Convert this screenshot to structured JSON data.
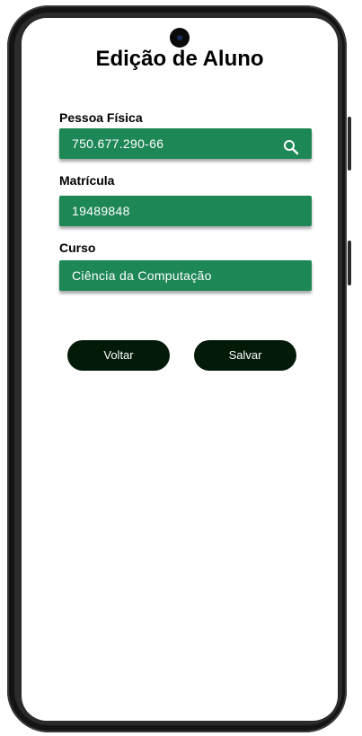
{
  "page": {
    "title": "Edição de Aluno"
  },
  "form": {
    "cpf": {
      "label": "Pessoa Física",
      "value": "750.677.290-66",
      "icon": "search-icon"
    },
    "matricula": {
      "label": "Matrícula",
      "value": "19489848"
    },
    "curso": {
      "label": "Curso",
      "value": "Ciência da Computação"
    }
  },
  "actions": {
    "back_label": "Voltar",
    "save_label": "Salvar"
  },
  "colors": {
    "field_bg": "#1e8756",
    "button_bg": "#031a09",
    "text_on_dark": "#ffffff"
  }
}
